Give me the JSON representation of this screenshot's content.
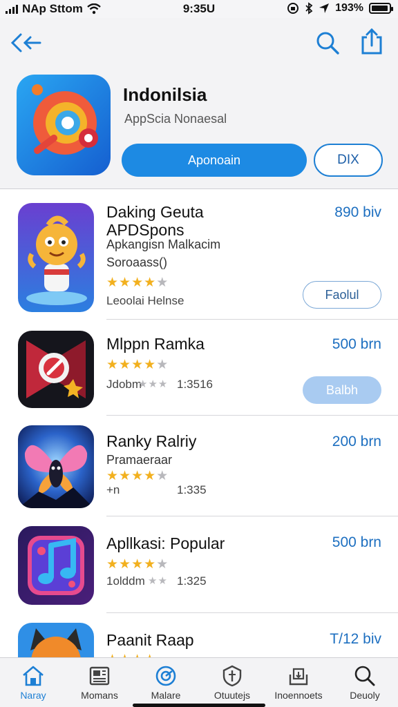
{
  "status_bar": {
    "carrier": "NAp Sttom",
    "time": "9:35U",
    "battery_percent": "193%",
    "battery_level": 0.95
  },
  "header": {
    "back_icon": "back-arrow-icon",
    "search_icon": "search-icon",
    "share_icon": "share-icon",
    "featured": {
      "title": "Indonilsia",
      "subtitle": "AppScia Nonaesal",
      "primary_button": "Aponoain",
      "secondary_button": "DIX",
      "icon": "featured-app-icon"
    }
  },
  "apps": [
    {
      "name": "Daking Geuta APDSpons",
      "description": "Apkangisn Malkacim",
      "extra": "Soroaass()",
      "rating": 4,
      "reviews": "Leoolai Helnse",
      "price": "890 biv",
      "button": "Faolul",
      "button_style": "outline",
      "icon": "mascot-app-icon"
    },
    {
      "name": "Mlppn Ramka",
      "rating": 4,
      "reviews": "Jdobm",
      "meta": "1:3516",
      "price": "500 brn",
      "button": "Balbh",
      "button_style": "filled",
      "icon": "pick-app-icon"
    },
    {
      "name": "Ranky Ralriy",
      "description": "Pramaeraar",
      "rating": 4,
      "reviews": "+n",
      "meta": "1:335",
      "price": "200 brn",
      "icon": "butterfly-app-icon"
    },
    {
      "name": "Apllkasi: Popular",
      "rating": 4,
      "reviews": "1olddm",
      "meta": "1:325",
      "price": "500 brn",
      "icon": "music-app-icon"
    },
    {
      "name": "Paanit Raap",
      "price": "T/12 biv",
      "icon": "fox-app-icon"
    }
  ],
  "tabs": [
    {
      "label": "Naray",
      "icon": "home-icon",
      "active": true
    },
    {
      "label": "Momans",
      "icon": "news-icon",
      "active": false
    },
    {
      "label": "Malare",
      "icon": "compass-icon",
      "active": false
    },
    {
      "label": "Otuutejs",
      "icon": "shield-icon",
      "active": false
    },
    {
      "label": "Inoennoets",
      "icon": "download-icon",
      "active": false
    },
    {
      "label": "Deuoly",
      "icon": "search-icon",
      "active": false
    }
  ],
  "colors": {
    "accent": "#1d8ae3",
    "price": "#1d6fc0",
    "star": "#f2b01e"
  }
}
